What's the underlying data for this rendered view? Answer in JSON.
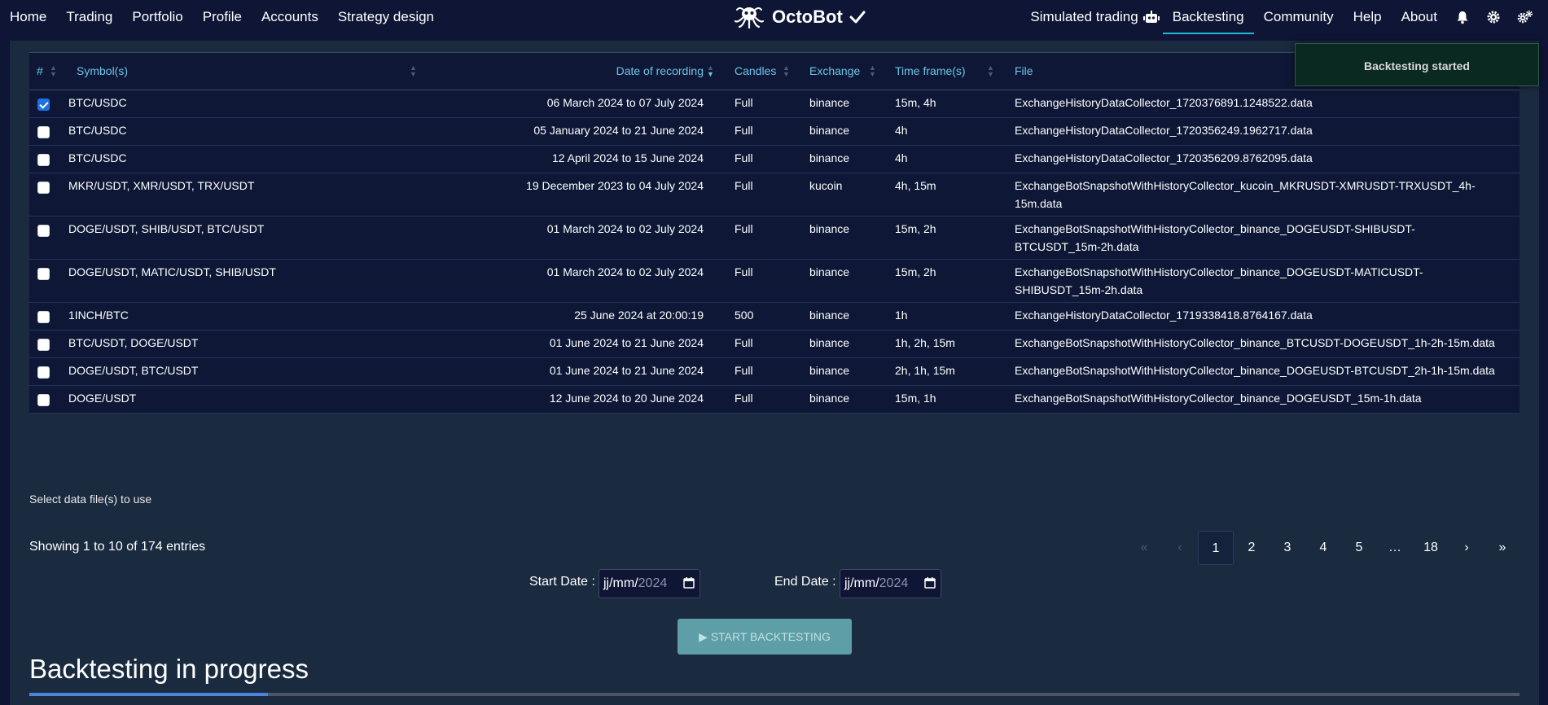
{
  "nav": {
    "left": [
      "Home",
      "Trading",
      "Portfolio",
      "Profile",
      "Accounts",
      "Strategy design"
    ],
    "brand": "OctoBot",
    "simulated": "Simulated trading",
    "right": [
      "Backtesting",
      "Community",
      "Help",
      "About"
    ],
    "active": "Backtesting",
    "icons": [
      "robot-icon",
      "bell-icon",
      "gear-icon",
      "gears-icon"
    ]
  },
  "toast": {
    "message": "Backtesting started"
  },
  "table": {
    "headers": {
      "num": "#",
      "symbols": "Symbol(s)",
      "date": "Date of recording",
      "candles": "Candles",
      "exchange": "Exchange",
      "timeframes": "Time frame(s)",
      "file": "File"
    },
    "rows": [
      {
        "checked": true,
        "symbols": "BTC/USDC",
        "date": "06 March 2024 to 07 July 2024",
        "candles": "Full",
        "exchange": "binance",
        "timeframes": "15m, 4h",
        "file": [
          "ExchangeHistoryDataCollector_1720376891.1248522.data"
        ]
      },
      {
        "checked": false,
        "symbols": "BTC/USDC",
        "date": "05 January 2024 to 21 June 2024",
        "candles": "Full",
        "exchange": "binance",
        "timeframes": "4h",
        "file": [
          "ExchangeHistoryDataCollector_1720356249.1962717.data"
        ]
      },
      {
        "checked": false,
        "symbols": "BTC/USDC",
        "date": "12 April 2024 to 15 June 2024",
        "candles": "Full",
        "exchange": "binance",
        "timeframes": "4h",
        "file": [
          "ExchangeHistoryDataCollector_1720356209.8762095.data"
        ]
      },
      {
        "checked": false,
        "symbols": "MKR/USDT, XMR/USDT, TRX/USDT",
        "date": "19 December 2023 to 04 July 2024",
        "candles": "Full",
        "exchange": "kucoin",
        "timeframes": "4h, 15m",
        "file": [
          "ExchangeBotSnapshotWithHistoryCollector_kucoin_MKRUSDT-XMRUSDT-TRXUSDT_4h-",
          "15m.data"
        ]
      },
      {
        "checked": false,
        "symbols": "DOGE/USDT, SHIB/USDT, BTC/USDT",
        "date": "01 March 2024 to 02 July 2024",
        "candles": "Full",
        "exchange": "binance",
        "timeframes": "15m, 2h",
        "file": [
          "ExchangeBotSnapshotWithHistoryCollector_binance_DOGEUSDT-SHIBUSDT-",
          "BTCUSDT_15m-2h.data"
        ]
      },
      {
        "checked": false,
        "symbols": "DOGE/USDT, MATIC/USDT, SHIB/USDT",
        "date": "01 March 2024 to 02 July 2024",
        "candles": "Full",
        "exchange": "binance",
        "timeframes": "15m, 2h",
        "file": [
          "ExchangeBotSnapshotWithHistoryCollector_binance_DOGEUSDT-MATICUSDT-",
          "SHIBUSDT_15m-2h.data"
        ]
      },
      {
        "checked": false,
        "symbols": "1INCH/BTC",
        "date": "25 June 2024 at 20:00:19",
        "candles": "500",
        "exchange": "binance",
        "timeframes": "1h",
        "file": [
          "ExchangeHistoryDataCollector_1719338418.8764167.data"
        ]
      },
      {
        "checked": false,
        "symbols": "BTC/USDT, DOGE/USDT",
        "date": "01 June 2024 to 21 June 2024",
        "candles": "Full",
        "exchange": "binance",
        "timeframes": "1h, 2h, 15m",
        "file": [
          "ExchangeBotSnapshotWithHistoryCollector_binance_BTCUSDT-DOGEUSDT_1h-2h-15m.data"
        ]
      },
      {
        "checked": false,
        "symbols": "DOGE/USDT, BTC/USDT",
        "date": "01 June 2024 to 21 June 2024",
        "candles": "Full",
        "exchange": "binance",
        "timeframes": "2h, 1h, 15m",
        "file": [
          "ExchangeBotSnapshotWithHistoryCollector_binance_DOGEUSDT-BTCUSDT_2h-1h-15m.data"
        ]
      },
      {
        "checked": false,
        "symbols": "DOGE/USDT",
        "date": "12 June 2024 to 20 June 2024",
        "candles": "Full",
        "exchange": "binance",
        "timeframes": "15m, 1h",
        "file": [
          "ExchangeBotSnapshotWithHistoryCollector_binance_DOGEUSDT_15m-1h.data"
        ]
      }
    ]
  },
  "select_hint": "Select data file(s) to use",
  "showing": "Showing 1 to 10 of 174 entries",
  "pagination": {
    "items": [
      "«",
      "‹",
      "1",
      "2",
      "3",
      "4",
      "5",
      "…",
      "18",
      "›",
      "»"
    ],
    "active": "1",
    "disabled": [
      "«",
      "‹"
    ]
  },
  "dates": {
    "start_label": "Start Date :",
    "end_label": "End Date :",
    "start_value": "jj/mm/",
    "start_year": "2024",
    "end_value": "jj/mm/",
    "end_year": "2024"
  },
  "start_button": "START BACKTESTING",
  "progress": {
    "title": "Backtesting in progress",
    "fraction": 0.16
  },
  "colors": {
    "background": "#0f1535",
    "panel": "#1a2a3f",
    "accent": "#1db9d6",
    "header_text": "#6fc3e8",
    "progress": "#4b85d9",
    "button": "#5e9ea6"
  }
}
